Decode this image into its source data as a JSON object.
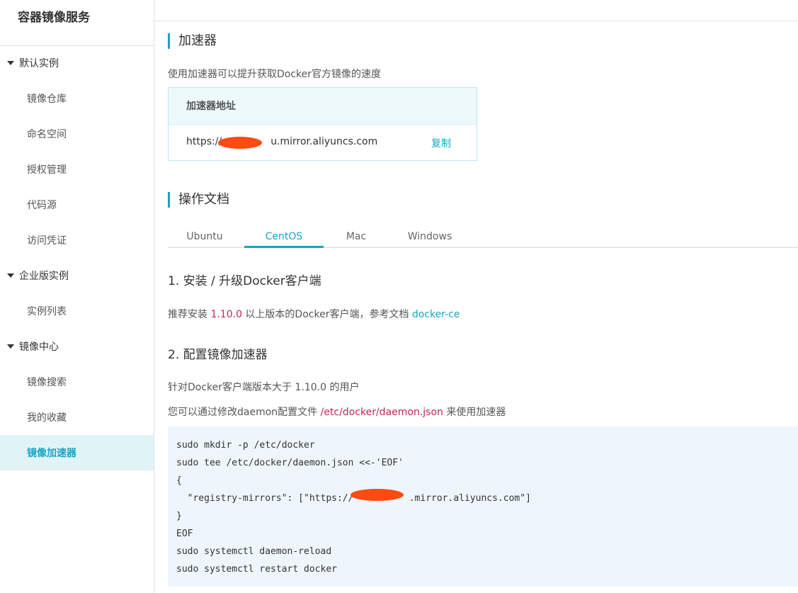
{
  "sidebar": {
    "title": "容器镜像服务",
    "groups": [
      {
        "label": "默认实例",
        "items": [
          "镜像仓库",
          "命名空间",
          "授权管理",
          "代码源",
          "访问凭证"
        ]
      },
      {
        "label": "企业版实例",
        "items": [
          "实例列表"
        ]
      },
      {
        "label": "镜像中心",
        "items": [
          "镜像搜索",
          "我的收藏",
          "镜像加速器"
        ]
      }
    ],
    "active_item": "镜像加速器"
  },
  "accelerator": {
    "section_title": "加速器",
    "description": "使用加速器可以提升获取Docker官方镜像的速度",
    "table_header": "加速器地址",
    "url_prefix": "https://",
    "url_suffix": "u.mirror.aliyuncs.com",
    "copy_label": "复制"
  },
  "docs": {
    "section_title": "操作文档",
    "tabs": [
      "Ubuntu",
      "CentOS",
      "Mac",
      "Windows"
    ],
    "active_tab": "CentOS",
    "step1": {
      "title": "1. 安装 / 升级Docker客户端",
      "text_before": "推荐安装 ",
      "version": "1.10.0",
      "text_after": " 以上版本的Docker客户端，参考文档 ",
      "link": "docker-ce"
    },
    "step2": {
      "title": "2. 配置镜像加速器",
      "line1": "针对Docker客户端版本大于 1.10.0 的用户",
      "line2_before": "您可以通过修改daemon配置文件 ",
      "line2_path": "/etc/docker/daemon.json",
      "line2_after": " 来使用加速器"
    },
    "code_lines": [
      "sudo mkdir -p /etc/docker",
      "sudo tee /etc/docker/daemon.json <<-'EOF'",
      "{",
      "  \"registry-mirrors\": [\"https://          .mirror.aliyuncs.com\"]",
      "}",
      "EOF",
      "sudo systemctl daemon-reload",
      "sudo systemctl restart docker"
    ]
  },
  "colors": {
    "accent": "#1aa4c5",
    "highlight": "#c7254e",
    "redaction": "#ff4a12"
  }
}
